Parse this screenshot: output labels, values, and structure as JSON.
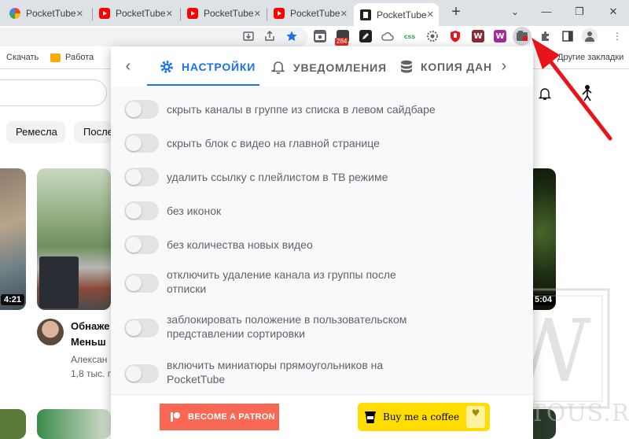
{
  "browser": {
    "tabs": [
      {
        "title": "PocketTube",
        "favicon": "rainbow-icon"
      },
      {
        "title": "PocketTube",
        "favicon": "youtube-icon"
      },
      {
        "title": "PocketTube",
        "favicon": "youtube-icon"
      },
      {
        "title": "PocketTube",
        "favicon": "youtube-icon"
      },
      {
        "title": "PocketTube",
        "favicon": "pockettube-icon"
      }
    ],
    "close_glyph": "✕",
    "new_tab_glyph": "+",
    "window_controls": {
      "minimize": "—",
      "maximize": "❐",
      "close": "✕"
    },
    "extension_badge": "284",
    "extension_css_label": "css",
    "extension_w_label": "W"
  },
  "bookmarks": {
    "download": "Скачать",
    "work": "Работа",
    "other": "Другие закладки"
  },
  "youtube": {
    "chips": [
      "Ремесла",
      "После"
    ],
    "videos": [
      {
        "duration": "4:21"
      },
      {
        "title_line1": "Обнаже",
        "title_line2": "Меньш",
        "channel": "Алексан",
        "views": "1,8 тыс. п"
      },
      {
        "duration": "5:04"
      }
    ]
  },
  "popup": {
    "tabs": [
      {
        "label": "НАСТРОЙКИ",
        "icon": "gear-icon",
        "active": true
      },
      {
        "label": "УВЕДОМЛЕНИЯ",
        "icon": "bell-icon",
        "active": false
      },
      {
        "label": "КОПИЯ ДАН",
        "icon": "database-icon",
        "active": false
      }
    ],
    "prev_arrow": "‹",
    "next_arrow": "›",
    "settings": [
      {
        "label": "скрыть каналы в группе из списка в левом сайдбаре",
        "enabled": false
      },
      {
        "label": "скрыть блок с видео на главной странице",
        "enabled": false
      },
      {
        "label": "удалить ссылку с плейлистом в ТВ режиме",
        "enabled": false
      },
      {
        "label": "без иконок",
        "enabled": false
      },
      {
        "label": "без количества новых видео",
        "enabled": false
      },
      {
        "label": "отключить удаление канала из группы после отписки",
        "enabled": false
      },
      {
        "label": "заблокировать положение в пользовательском представлении сортировки",
        "enabled": false
      },
      {
        "label": "включить миниатюры прямоугольников на PocketTube",
        "enabled": false
      }
    ],
    "footer": {
      "patron_label": "BECOME A PATRON",
      "coffee_label": "Buy me a coffee"
    }
  },
  "watermark": {
    "text": "WEBTOUS.RU",
    "letter": "W"
  },
  "colors": {
    "accent": "#1a73e8",
    "patron": "#f96854",
    "coffee": "#ffdd00",
    "annotation_arrow": "#e8141c"
  }
}
